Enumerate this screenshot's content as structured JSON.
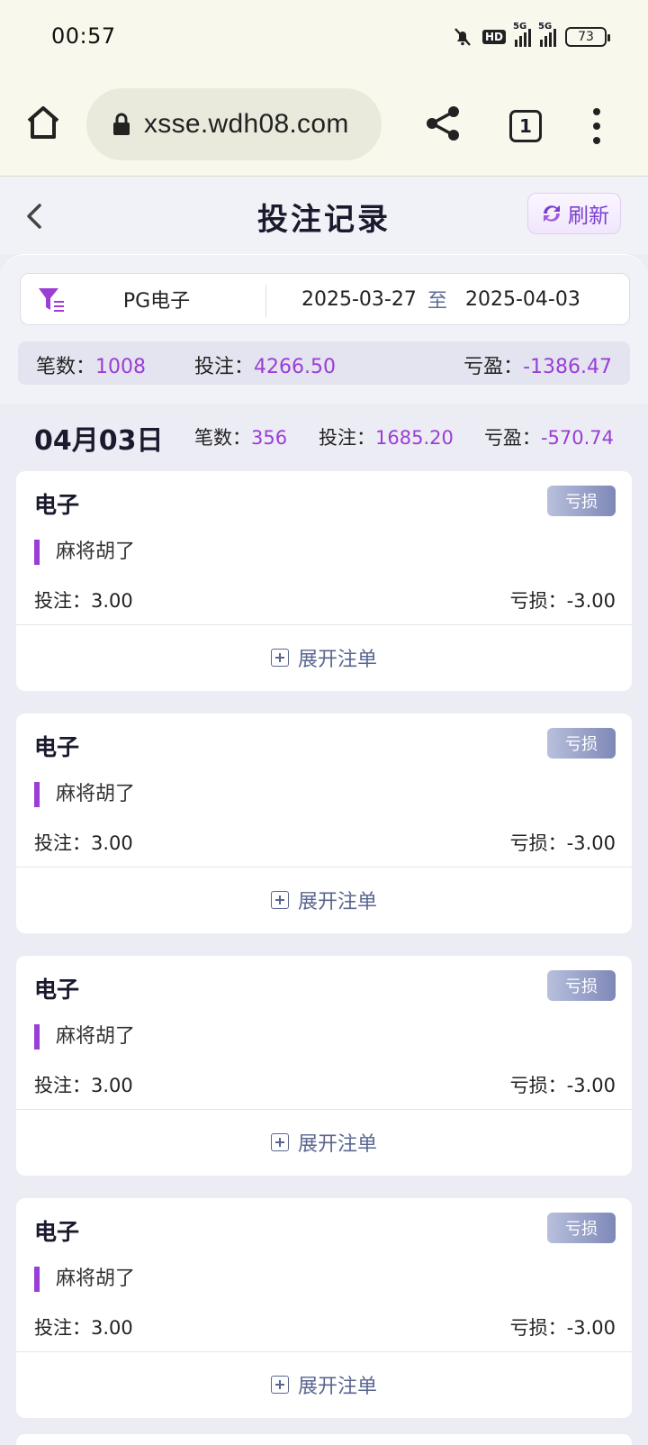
{
  "status_bar": {
    "time": "00:57",
    "hd_label": "HD",
    "signal1_label": "5G",
    "signal2_label": "5G",
    "battery": "73"
  },
  "browser": {
    "url": "xsse.wdh08.com",
    "tab_count": "1"
  },
  "header": {
    "title": "投注记录",
    "refresh_label": "刷新"
  },
  "filter": {
    "game": "PG电子",
    "start_date": "2025-03-27",
    "to_label": "至",
    "end_date": "2025-04-03"
  },
  "summary": {
    "count_label": "笔数：",
    "count": "1008",
    "bet_label": "投注：",
    "bet": "4266.50",
    "profit_label": "亏盈：",
    "profit": "-1386.47"
  },
  "day": {
    "date": "04月03日",
    "count_label": "笔数：",
    "count": "356",
    "bet_label": "投注：",
    "bet": "1685.20",
    "profit_label": "亏盈：",
    "profit": "-570.74"
  },
  "records": [
    {
      "title": "电子",
      "badge": "亏损",
      "game": "麻将胡了",
      "bet_label": "投注：",
      "bet": "3.00",
      "loss_label": "亏损：",
      "loss": "-3.00",
      "expand_label": "展开注单"
    },
    {
      "title": "电子",
      "badge": "亏损",
      "game": "麻将胡了",
      "bet_label": "投注：",
      "bet": "3.00",
      "loss_label": "亏损：",
      "loss": "-3.00",
      "expand_label": "展开注单"
    },
    {
      "title": "电子",
      "badge": "亏损",
      "game": "麻将胡了",
      "bet_label": "投注：",
      "bet": "3.00",
      "loss_label": "亏损：",
      "loss": "-3.00",
      "expand_label": "展开注单"
    },
    {
      "title": "电子",
      "badge": "亏损",
      "game": "麻将胡了",
      "bet_label": "投注：",
      "bet": "3.00",
      "loss_label": "亏损：",
      "loss": "-3.00",
      "expand_label": "展开注单"
    }
  ],
  "colors": {
    "accent": "#9a3ed6",
    "badge": "#7e88b8",
    "text_secondary": "#5a6690"
  }
}
